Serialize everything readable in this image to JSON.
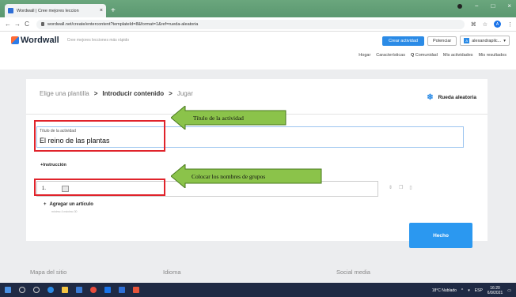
{
  "browser": {
    "tab_title": "Wordwall | Cree mejores leccion",
    "tab_close": "×",
    "new_tab": "+",
    "url": "wordwall.net/create/entercontent?templateId=8&format=1&ref=rueda-aleatoria",
    "back": "←",
    "forward": "→",
    "reload": "C",
    "star": "☆",
    "profile_initial": "A",
    "menu": "⋮",
    "minimize": "−",
    "maximize": "□",
    "close": "×"
  },
  "header": {
    "logo": "Wordwall",
    "tagline": "Cree mejores lecciones más rápido",
    "create_button": "Crear actividad",
    "upgrade_button": "Potenciar",
    "user_initial": "A",
    "user_name": "alexandrapilc...",
    "user_chevron": "▾"
  },
  "nav": {
    "items": [
      "Hogar",
      "Características",
      "Comunidad",
      "Mis actividades",
      "Mis resultados"
    ],
    "search_glyph": "Q"
  },
  "steps": {
    "step1": "Elige una plantilla",
    "step2": "Introducir contenido",
    "step3": "Jugar",
    "arrow": ">"
  },
  "template": {
    "name": "Rueda aleatoria",
    "icon_glyph": "❄"
  },
  "form": {
    "title_label": "Título de la actividad",
    "title_value": "El reino de las plantas",
    "instruction_label": "Instrucción",
    "item_number": "1.",
    "add_item_label": "Agregar un artículo",
    "min_max": "mínimo 4 máximo 30",
    "done_button": "Hecho",
    "plus": "+"
  },
  "annotations": {
    "callout1": "Título de la actividad",
    "callout2": "Colocar los nombres de grupos",
    "callout_color": "#8bc34a",
    "highlight_color": "#e0232b"
  },
  "footer": {
    "col1": "Mapa del sitio",
    "col2": "Idioma",
    "col3": "Social media"
  },
  "taskbar": {
    "weather": "18°C Nublado",
    "lang": "ESP",
    "time": "16:20",
    "date": "6/9/2021"
  }
}
